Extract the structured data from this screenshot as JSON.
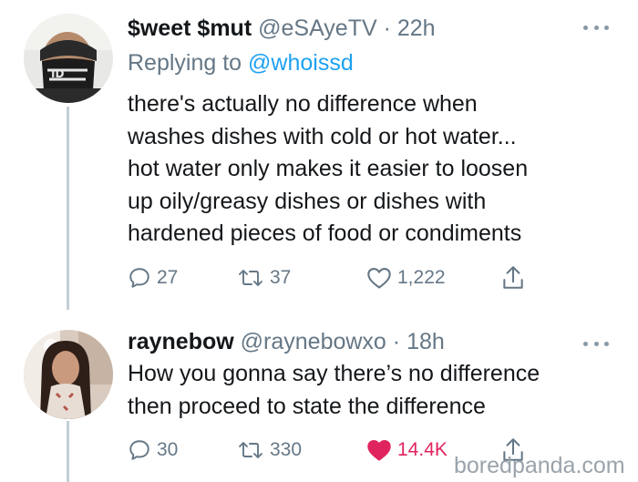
{
  "tweets": [
    {
      "display_name": "$weet $mut",
      "handle": "@eSAyeTV",
      "separator": "·",
      "time": "22h",
      "replying_prefix": "Replying to ",
      "replying_to": "@whoissd",
      "text_lines": [
        "there's actually no difference when",
        "washes dishes with cold or hot water...",
        "hot water only makes it easier to loosen",
        "up oily/greasy dishes or dishes with",
        "hardened pieces of food or condiments"
      ],
      "reply_count": "27",
      "retweet_count": "37",
      "like_count": "1,222",
      "liked": false
    },
    {
      "display_name": "raynebow",
      "handle": "@raynebowxo",
      "separator": "·",
      "time": "18h",
      "text_lines": [
        "How you gonna say there’s no difference",
        "then proceed to state the difference"
      ],
      "reply_count": "30",
      "retweet_count": "330",
      "like_count": "14.4K",
      "liked": true
    }
  ],
  "watermark": "boredpanda.com",
  "icons": {
    "reply": "reply-icon",
    "retweet": "retweet-icon",
    "like": "heart-icon",
    "share": "share-icon",
    "more": "more-options-icon"
  },
  "colors": {
    "text_primary": "#14171a",
    "text_secondary": "#657786",
    "link": "#1da1f2",
    "like_active": "#e0245e",
    "thread_line": "#c4cfd6"
  }
}
